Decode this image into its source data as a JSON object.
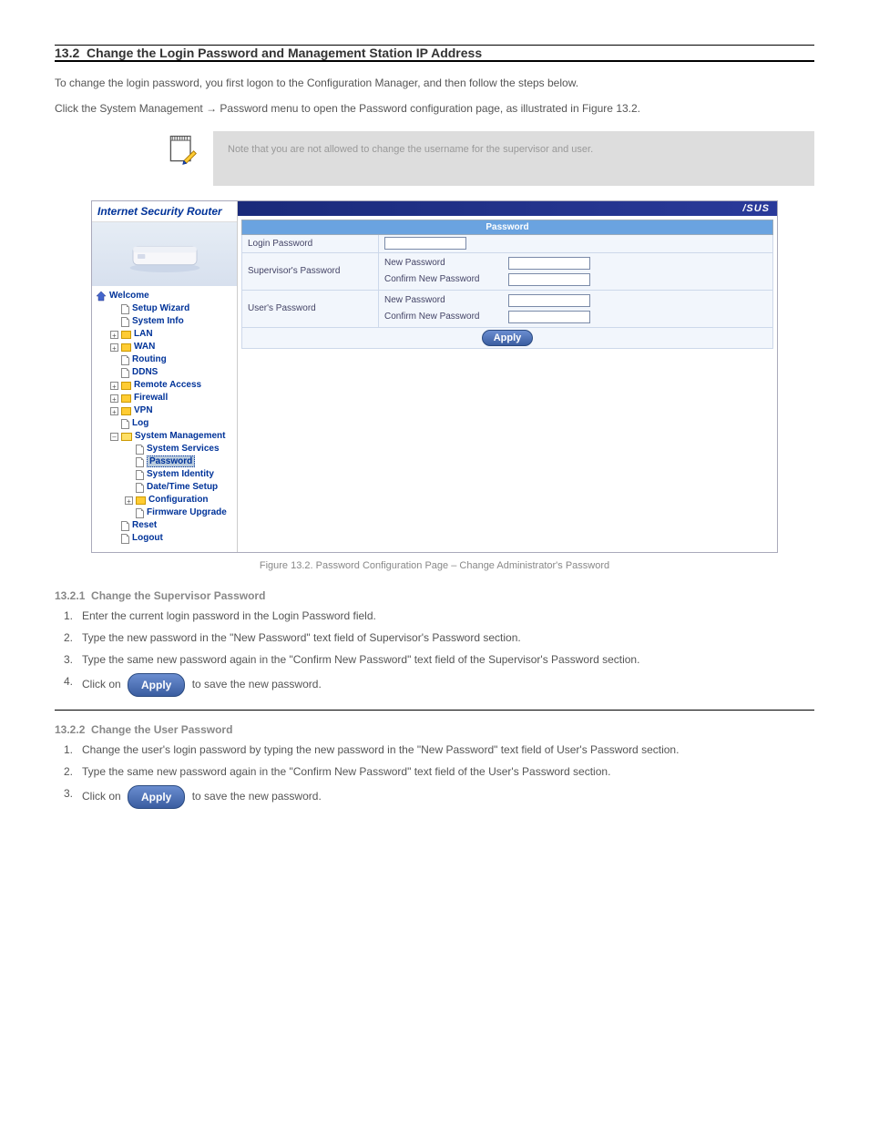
{
  "doc": {
    "chapter_header": "",
    "section_number": "13.2",
    "section_title": "Change the Login Password and Management Station IP Address",
    "intro_1": "To change the login password, you first logon to the Configuration Manager, and then follow the steps below.",
    "intro_2": "Click the System Management → Password menu to open the Password configuration page, as illustrated in Figure 13.2.",
    "note_text": "Note that you are not allowed to change the username for the supervisor and user.",
    "figure_caption": "Figure 13.2. Password Configuration Page – Change Administrator's Password",
    "sub1_num": "13.2.1",
    "sub1_title": "Change the Supervisor Password",
    "sub1_steps": [
      "Enter the current login password in the Login Password field.",
      "Type the new password in the \"New Password\" text field of Supervisor's Password section.",
      "Type the same new password again in the \"Confirm New Password\" text field of the Supervisor's Password section.",
      "Click on          to save the new password."
    ],
    "sub2_num": "13.2.2",
    "sub2_title": "Change the User Password",
    "sub2_steps": [
      "Change the user's login password by typing the new password in the \"New Password\" text field of User's Password section.",
      "Type the same new password again in the \"Confirm New Password\" text field of the User's Password section.",
      "Click on          to save the new password."
    ],
    "apply_label": "Apply"
  },
  "router": {
    "brand": "Internet Security Router",
    "asus": "/SUS",
    "panel_title": "Password",
    "rows": {
      "login": "Login Password",
      "supervisor": "Supervisor's Password",
      "user": "User's Password",
      "new_pw": "New Password",
      "confirm_pw": "Confirm New Password"
    },
    "tree": {
      "welcome": "Welcome",
      "setup_wizard": "Setup Wizard",
      "system_info": "System Info",
      "lan": "LAN",
      "wan": "WAN",
      "routing": "Routing",
      "ddns": "DDNS",
      "remote_access": "Remote Access",
      "firewall": "Firewall",
      "vpn": "VPN",
      "log": "Log",
      "sys_mgmt": "System Management",
      "sys_services": "System Services",
      "password": "Password",
      "sys_identity": "System Identity",
      "datetime": "Date/Time Setup",
      "configuration": "Configuration",
      "fw_upgrade": "Firmware Upgrade",
      "reset": "Reset",
      "logout": "Logout"
    }
  }
}
